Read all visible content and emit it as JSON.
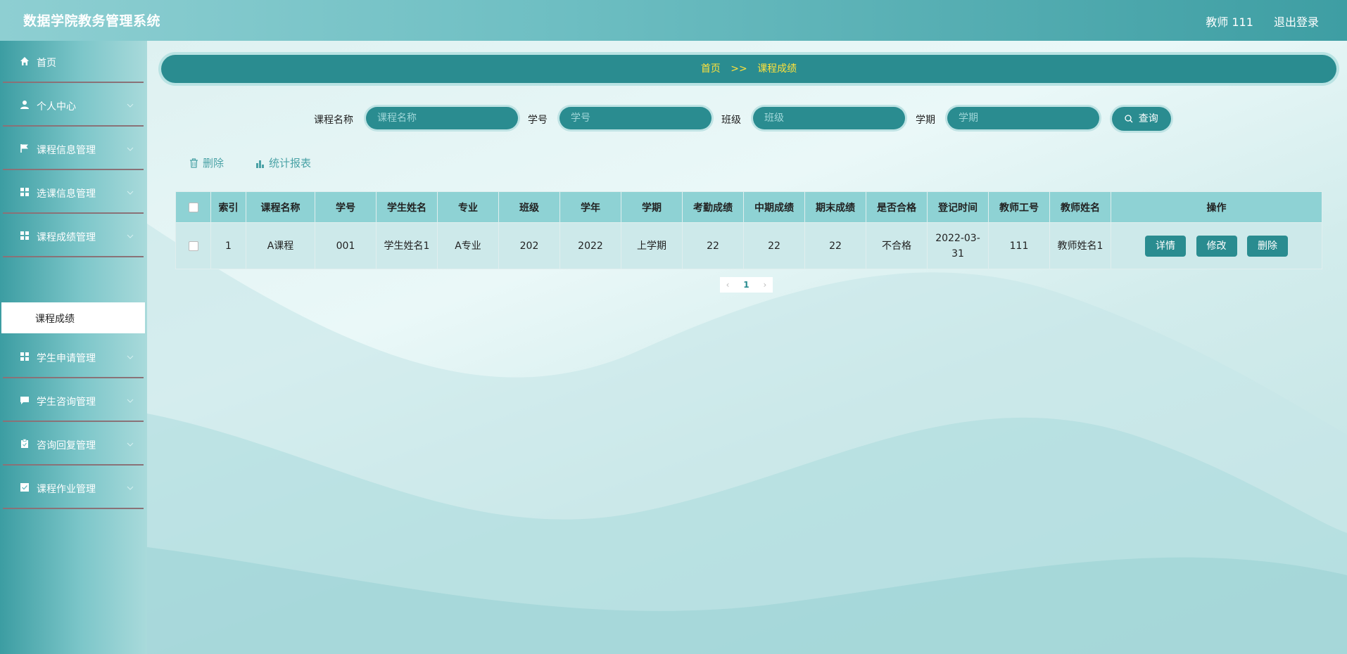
{
  "header": {
    "title": "数据学院教务管理系统",
    "user": "教师 111",
    "logout": "退出登录"
  },
  "sidebar": {
    "items": [
      {
        "label": "首页"
      },
      {
        "label": "个人中心"
      },
      {
        "label": "课程信息管理"
      },
      {
        "label": "选课信息管理"
      },
      {
        "label": "课程成绩管理"
      },
      {
        "label": "学生申请管理"
      },
      {
        "label": "学生咨询管理"
      },
      {
        "label": "咨询回复管理"
      },
      {
        "label": "课程作业管理"
      }
    ],
    "active_sub": "课程成绩"
  },
  "breadcrumb": {
    "home": "首页",
    "separator": ">>",
    "current": "课程成绩"
  },
  "search": {
    "course_label": "课程名称",
    "course_placeholder": "课程名称",
    "id_label": "学号",
    "id_placeholder": "学号",
    "class_label": "班级",
    "class_placeholder": "班级",
    "term_label": "学期",
    "term_placeholder": "学期",
    "query_button": "查询"
  },
  "actions": {
    "delete": "删除",
    "report": "统计报表"
  },
  "table": {
    "headers": [
      "索引",
      "课程名称",
      "学号",
      "学生姓名",
      "专业",
      "班级",
      "学年",
      "学期",
      "考勤成绩",
      "中期成绩",
      "期末成绩",
      "是否合格",
      "登记时间",
      "教师工号",
      "教师姓名",
      "操作"
    ],
    "rows": [
      [
        "1",
        "A课程",
        "001",
        "学生姓名1",
        "A专业",
        "202",
        "2022",
        "上学期",
        "22",
        "22",
        "22",
        "不合格",
        "2022-03-31",
        "111",
        "教师姓名1"
      ]
    ],
    "row_buttons": {
      "detail": "详情",
      "edit": "修改",
      "delete": "删除"
    }
  },
  "pagination": {
    "current_page": "1"
  },
  "colors": {
    "primary": "#2a8c90",
    "header_bg": "#8ed2d4",
    "breadcrumb_text": "#ffe23b"
  }
}
